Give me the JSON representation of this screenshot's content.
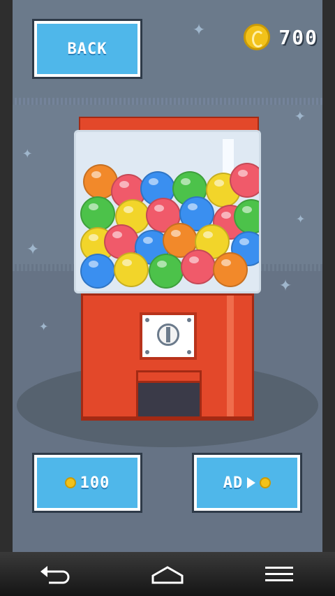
{
  "header": {
    "back_label": "BACK",
    "coin_icon": "coin-icon",
    "coin_count": "700"
  },
  "machine": {
    "gumballs": [
      {
        "color": "#f2892a"
      },
      {
        "color": "#f05a6a"
      },
      {
        "color": "#3a8ff0"
      },
      {
        "color": "#4cc24a"
      },
      {
        "color": "#f2d52a"
      },
      {
        "color": "#f05a6a"
      },
      {
        "color": "#4cc24a"
      },
      {
        "color": "#f2d52a"
      },
      {
        "color": "#f05a6a"
      },
      {
        "color": "#3a8ff0"
      },
      {
        "color": "#f05a6a"
      },
      {
        "color": "#4cc24a"
      },
      {
        "color": "#f2d52a"
      },
      {
        "color": "#f05a6a"
      },
      {
        "color": "#3a8ff0"
      },
      {
        "color": "#f2892a"
      },
      {
        "color": "#f2d52a"
      },
      {
        "color": "#3a8ff0"
      },
      {
        "color": "#3a8ff0"
      },
      {
        "color": "#f2d52a"
      },
      {
        "color": "#4cc24a"
      },
      {
        "color": "#f05a6a"
      },
      {
        "color": "#f2892a"
      }
    ]
  },
  "buttons": {
    "buy_label": "100",
    "ad_label": "AD",
    "play_icon": "play-icon"
  },
  "navbar": {
    "back_icon": "back-arrow-icon",
    "home_icon": "home-icon",
    "menu_icon": "menu-icon"
  },
  "colors": {
    "button_blue": "#4fb7ea",
    "machine_red": "#e3482a",
    "coin_gold": "#f2c21a"
  }
}
